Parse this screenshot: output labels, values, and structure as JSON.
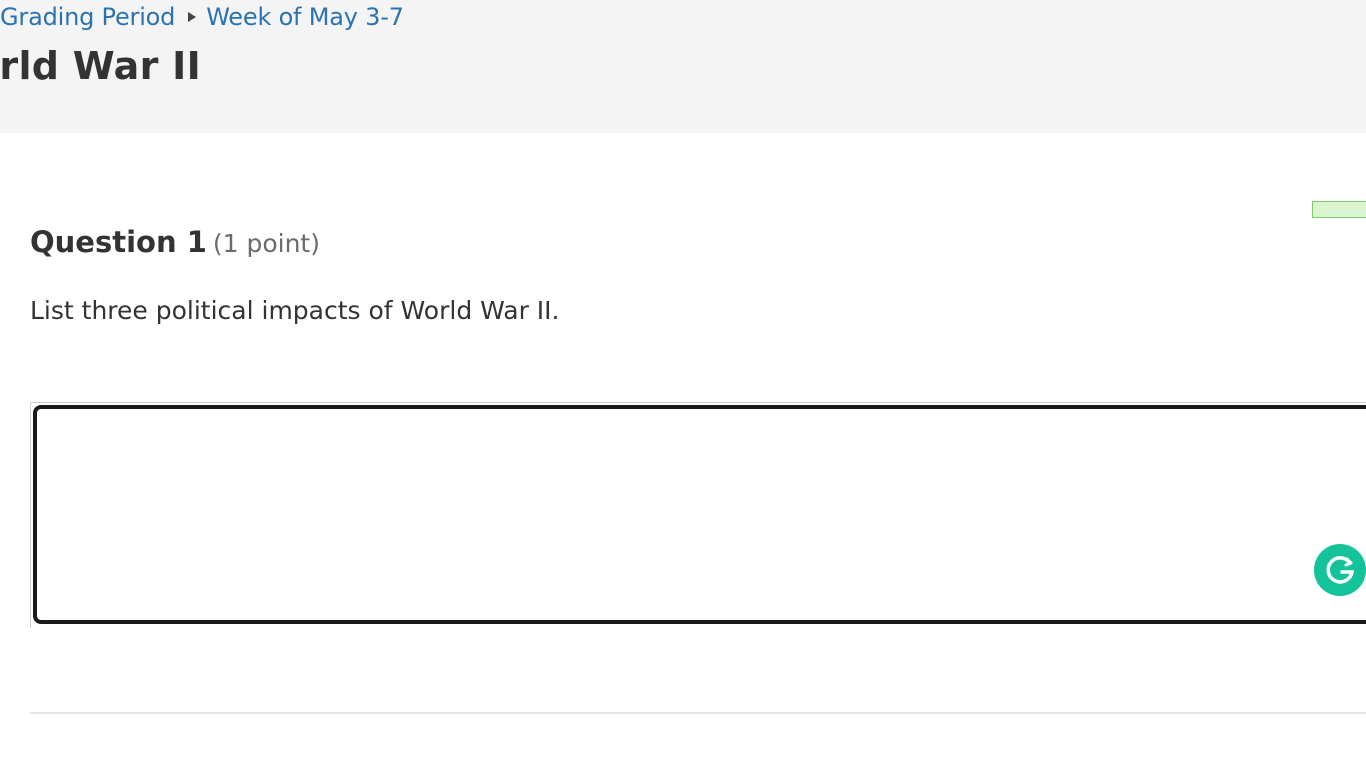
{
  "breadcrumb": {
    "items": [
      "Grading Period",
      "Week of May 3-7"
    ]
  },
  "page": {
    "title": "orld War II"
  },
  "question": {
    "heading": "Question 1",
    "points": "(1 point)",
    "prompt": "List three political impacts of World War II."
  },
  "answer": {
    "value": "",
    "placeholder": ""
  },
  "icons": {
    "breadcrumb_separator": "triangle-right-icon",
    "grammarly": "grammarly-icon"
  },
  "colors": {
    "link": "#2b73b0",
    "header_bg": "#f4f4f4",
    "grammarly": "#15c39a",
    "progress": "#d8f5cf"
  }
}
